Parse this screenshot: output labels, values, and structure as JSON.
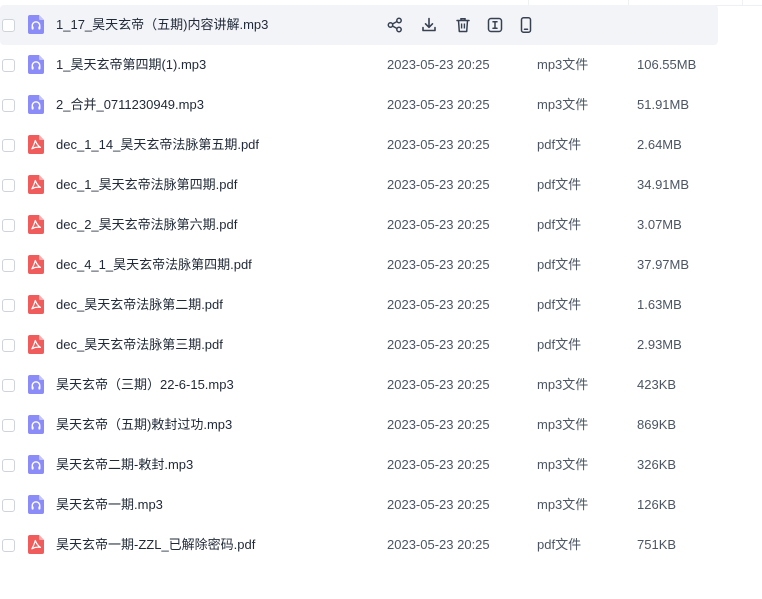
{
  "colors": {
    "audio_icon": "#8b8cf7",
    "pdf_icon": "#f05b5b",
    "row_hover": "#f3f4f8"
  },
  "row_actions": [
    {
      "name": "share-icon"
    },
    {
      "name": "download-icon"
    },
    {
      "name": "delete-icon"
    },
    {
      "name": "rename-icon"
    },
    {
      "name": "mobile-icon"
    }
  ],
  "files": [
    {
      "name": "1_17_昊天玄帝（五期)内容讲解.mp3",
      "date": "",
      "type": "",
      "size": "",
      "icon": "audio-file-icon",
      "hovered": true
    },
    {
      "name": "1_昊天玄帝第四期(1).mp3",
      "date": "2023-05-23 20:25",
      "type": "mp3文件",
      "size": "106.55MB",
      "icon": "audio-file-icon"
    },
    {
      "name": "2_合并_0711230949.mp3",
      "date": "2023-05-23 20:25",
      "type": "mp3文件",
      "size": "51.91MB",
      "icon": "audio-file-icon"
    },
    {
      "name": "dec_1_14_昊天玄帝法脉第五期.pdf",
      "date": "2023-05-23 20:25",
      "type": "pdf文件",
      "size": "2.64MB",
      "icon": "pdf-file-icon"
    },
    {
      "name": "dec_1_昊天玄帝法脉第四期.pdf",
      "date": "2023-05-23 20:25",
      "type": "pdf文件",
      "size": "34.91MB",
      "icon": "pdf-file-icon"
    },
    {
      "name": "dec_2_昊天玄帝法脉第六期.pdf",
      "date": "2023-05-23 20:25",
      "type": "pdf文件",
      "size": "3.07MB",
      "icon": "pdf-file-icon"
    },
    {
      "name": "dec_4_1_昊天玄帝法脉第四期.pdf",
      "date": "2023-05-23 20:25",
      "type": "pdf文件",
      "size": "37.97MB",
      "icon": "pdf-file-icon"
    },
    {
      "name": "dec_昊天玄帝法脉第二期.pdf",
      "date": "2023-05-23 20:25",
      "type": "pdf文件",
      "size": "1.63MB",
      "icon": "pdf-file-icon"
    },
    {
      "name": "dec_昊天玄帝法脉第三期.pdf",
      "date": "2023-05-23 20:25",
      "type": "pdf文件",
      "size": "2.93MB",
      "icon": "pdf-file-icon"
    },
    {
      "name": "昊天玄帝（三期）22-6-15.mp3",
      "date": "2023-05-23 20:25",
      "type": "mp3文件",
      "size": "423KB",
      "icon": "audio-file-icon"
    },
    {
      "name": "昊天玄帝（五期)敕封过功.mp3",
      "date": "2023-05-23 20:25",
      "type": "mp3文件",
      "size": "869KB",
      "icon": "audio-file-icon"
    },
    {
      "name": "昊天玄帝二期-敕封.mp3",
      "date": "2023-05-23 20:25",
      "type": "mp3文件",
      "size": "326KB",
      "icon": "audio-file-icon"
    },
    {
      "name": "昊天玄帝一期.mp3",
      "date": "2023-05-23 20:25",
      "type": "mp3文件",
      "size": "126KB",
      "icon": "audio-file-icon"
    },
    {
      "name": "昊天玄帝一期-ZZL_已解除密码.pdf",
      "date": "2023-05-23 20:25",
      "type": "pdf文件",
      "size": "751KB",
      "icon": "pdf-file-icon"
    }
  ]
}
